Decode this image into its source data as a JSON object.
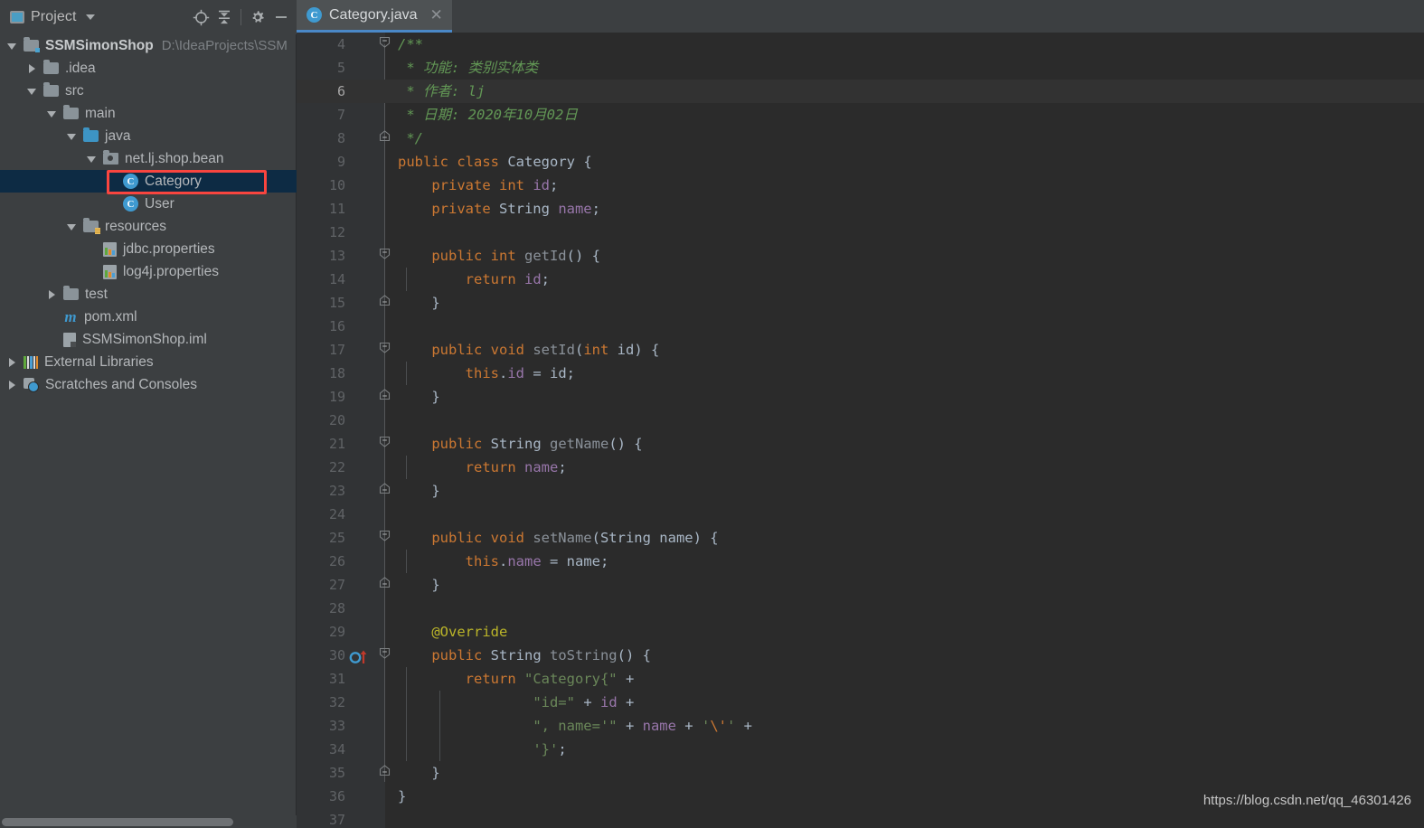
{
  "window": {
    "watermark": "https://blog.csdn.net/qq_46301426"
  },
  "project_panel": {
    "title": "Project",
    "title_icon": "project-view-icon",
    "dropdown_icon": "chevron-down-icon",
    "actions": [
      {
        "name": "locate-icon",
        "label": "Select Opened File"
      },
      {
        "name": "collapse-all-icon",
        "label": "Collapse All"
      },
      {
        "name": "gear-icon",
        "label": "Settings"
      },
      {
        "name": "minimize-icon",
        "label": "Hide"
      }
    ],
    "tree": [
      {
        "indent": 0,
        "twisty": "down",
        "icon": "module-folder-icon",
        "label": "SSMSimonShop",
        "bold": true,
        "path": "D:\\IdeaProjects\\SSM",
        "selected": false
      },
      {
        "indent": 1,
        "twisty": "right",
        "icon": "folder-icon",
        "label": ".idea",
        "bold": false,
        "path": "",
        "selected": false
      },
      {
        "indent": 1,
        "twisty": "down",
        "icon": "source-folder-icon",
        "label": "src",
        "bold": false,
        "path": "",
        "selected": false
      },
      {
        "indent": 2,
        "twisty": "down",
        "icon": "folder-icon",
        "label": "main",
        "bold": false,
        "path": "",
        "selected": false
      },
      {
        "indent": 3,
        "twisty": "down",
        "icon": "java-source-folder-icon",
        "label": "java",
        "bold": false,
        "path": "",
        "selected": false
      },
      {
        "indent": 4,
        "twisty": "down",
        "icon": "package-icon",
        "label": "net.lj.shop.bean",
        "bold": false,
        "path": "",
        "selected": false
      },
      {
        "indent": 5,
        "twisty": "none",
        "icon": "java-class-icon",
        "label": "Category",
        "bold": false,
        "path": "",
        "selected": true
      },
      {
        "indent": 5,
        "twisty": "none",
        "icon": "java-class-icon",
        "label": "User",
        "bold": false,
        "path": "",
        "selected": false
      },
      {
        "indent": 3,
        "twisty": "down",
        "icon": "resources-folder-icon",
        "label": "resources",
        "bold": false,
        "path": "",
        "selected": false
      },
      {
        "indent": 4,
        "twisty": "none",
        "icon": "properties-file-icon",
        "label": "jdbc.properties",
        "bold": false,
        "path": "",
        "selected": false
      },
      {
        "indent": 4,
        "twisty": "none",
        "icon": "properties-file-icon",
        "label": "log4j.properties",
        "bold": false,
        "path": "",
        "selected": false
      },
      {
        "indent": 2,
        "twisty": "right",
        "icon": "folder-icon",
        "label": "test",
        "bold": false,
        "path": "",
        "selected": false
      },
      {
        "indent": 2,
        "twisty": "none",
        "icon": "maven-icon",
        "label": "pom.xml",
        "bold": false,
        "path": "",
        "selected": false
      },
      {
        "indent": 2,
        "twisty": "none",
        "icon": "iml-file-icon",
        "label": "SSMSimonShop.iml",
        "bold": false,
        "path": "",
        "selected": false
      },
      {
        "indent": 0,
        "twisty": "right",
        "icon": "libraries-icon",
        "label": "External Libraries",
        "bold": false,
        "path": "",
        "selected": false
      },
      {
        "indent": 0,
        "twisty": "right",
        "icon": "scratches-icon",
        "label": "Scratches and Consoles",
        "bold": false,
        "path": "",
        "selected": false
      }
    ],
    "annotation": {
      "shape": "rectangle",
      "color": "#f8453f",
      "target": "Category"
    }
  },
  "editor": {
    "tab": {
      "label": "Category.java",
      "icon": "java-class-icon",
      "close_icon": "close-icon",
      "active": true,
      "accent_color": "#4a88c7"
    },
    "caret_line": 6,
    "first_visible_line": 4,
    "last_visible_line": 37,
    "gutter_markers": [
      {
        "line": 30,
        "name": "override-method-marker-icon"
      }
    ],
    "lines": [
      {
        "n": 4,
        "fold": "open-top",
        "tokens": [
          {
            "t": "/**",
            "c": "cmt"
          }
        ],
        "indent": 0
      },
      {
        "n": 5,
        "fold": "none",
        "tokens": [
          {
            "t": " * 功能: 类别实体类",
            "c": "cmt"
          }
        ],
        "indent": 0
      },
      {
        "n": 6,
        "fold": "none",
        "tokens": [
          {
            "t": " * 作者: lj",
            "c": "cmt"
          }
        ],
        "indent": 0
      },
      {
        "n": 7,
        "fold": "none",
        "tokens": [
          {
            "t": " * 日期: 2020年10月02日",
            "c": "cmt"
          }
        ],
        "indent": 0
      },
      {
        "n": 8,
        "fold": "close",
        "tokens": [
          {
            "t": " */",
            "c": "cmt"
          }
        ],
        "indent": 0
      },
      {
        "n": 9,
        "fold": "none",
        "tokens": [
          {
            "t": "public class ",
            "c": "kw"
          },
          {
            "t": "Category ",
            "c": "cls"
          },
          {
            "t": "{",
            "c": "punc"
          }
        ],
        "indent": 0
      },
      {
        "n": 10,
        "fold": "none",
        "tokens": [
          {
            "t": "    ",
            "c": "punc"
          },
          {
            "t": "private int ",
            "c": "kw"
          },
          {
            "t": "id",
            "c": "fld"
          },
          {
            "t": ";",
            "c": "punc"
          }
        ],
        "indent": 0
      },
      {
        "n": 11,
        "fold": "none",
        "tokens": [
          {
            "t": "    ",
            "c": "punc"
          },
          {
            "t": "private ",
            "c": "kw"
          },
          {
            "t": "String ",
            "c": "cls"
          },
          {
            "t": "name",
            "c": "fld"
          },
          {
            "t": ";",
            "c": "punc"
          }
        ],
        "indent": 0
      },
      {
        "n": 12,
        "fold": "none",
        "tokens": [],
        "indent": 0
      },
      {
        "n": 13,
        "fold": "open",
        "tokens": [
          {
            "t": "    ",
            "c": "punc"
          },
          {
            "t": "public int ",
            "c": "kw"
          },
          {
            "t": "getId",
            "c": "mth"
          },
          {
            "t": "() {",
            "c": "punc"
          }
        ],
        "indent": 0
      },
      {
        "n": 14,
        "fold": "none",
        "tokens": [
          {
            "t": "        ",
            "c": "punc"
          },
          {
            "t": "return ",
            "c": "kw"
          },
          {
            "t": "id",
            "c": "fld"
          },
          {
            "t": ";",
            "c": "punc"
          }
        ],
        "indent": 1
      },
      {
        "n": 15,
        "fold": "close",
        "tokens": [
          {
            "t": "    }",
            "c": "punc"
          }
        ],
        "indent": 0
      },
      {
        "n": 16,
        "fold": "none",
        "tokens": [],
        "indent": 0
      },
      {
        "n": 17,
        "fold": "open",
        "tokens": [
          {
            "t": "    ",
            "c": "punc"
          },
          {
            "t": "public void ",
            "c": "kw"
          },
          {
            "t": "setId",
            "c": "mth"
          },
          {
            "t": "(",
            "c": "punc"
          },
          {
            "t": "int ",
            "c": "kw"
          },
          {
            "t": "id",
            "c": "id"
          },
          {
            "t": ") {",
            "c": "punc"
          }
        ],
        "indent": 0
      },
      {
        "n": 18,
        "fold": "none",
        "tokens": [
          {
            "t": "        ",
            "c": "punc"
          },
          {
            "t": "this",
            "c": "kw"
          },
          {
            "t": ".",
            "c": "punc"
          },
          {
            "t": "id",
            "c": "fld"
          },
          {
            "t": " = id;",
            "c": "punc"
          }
        ],
        "indent": 1
      },
      {
        "n": 19,
        "fold": "close",
        "tokens": [
          {
            "t": "    }",
            "c": "punc"
          }
        ],
        "indent": 0
      },
      {
        "n": 20,
        "fold": "none",
        "tokens": [],
        "indent": 0
      },
      {
        "n": 21,
        "fold": "open",
        "tokens": [
          {
            "t": "    ",
            "c": "punc"
          },
          {
            "t": "public ",
            "c": "kw"
          },
          {
            "t": "String ",
            "c": "cls"
          },
          {
            "t": "getName",
            "c": "mth"
          },
          {
            "t": "() {",
            "c": "punc"
          }
        ],
        "indent": 0
      },
      {
        "n": 22,
        "fold": "none",
        "tokens": [
          {
            "t": "        ",
            "c": "punc"
          },
          {
            "t": "return ",
            "c": "kw"
          },
          {
            "t": "name",
            "c": "fld"
          },
          {
            "t": ";",
            "c": "punc"
          }
        ],
        "indent": 1
      },
      {
        "n": 23,
        "fold": "close",
        "tokens": [
          {
            "t": "    }",
            "c": "punc"
          }
        ],
        "indent": 0
      },
      {
        "n": 24,
        "fold": "none",
        "tokens": [],
        "indent": 0
      },
      {
        "n": 25,
        "fold": "open",
        "tokens": [
          {
            "t": "    ",
            "c": "punc"
          },
          {
            "t": "public void ",
            "c": "kw"
          },
          {
            "t": "setName",
            "c": "mth"
          },
          {
            "t": "(String name) {",
            "c": "punc"
          }
        ],
        "indent": 0
      },
      {
        "n": 26,
        "fold": "none",
        "tokens": [
          {
            "t": "        ",
            "c": "punc"
          },
          {
            "t": "this",
            "c": "kw"
          },
          {
            "t": ".",
            "c": "punc"
          },
          {
            "t": "name",
            "c": "fld"
          },
          {
            "t": " = name;",
            "c": "punc"
          }
        ],
        "indent": 1
      },
      {
        "n": 27,
        "fold": "close",
        "tokens": [
          {
            "t": "    }",
            "c": "punc"
          }
        ],
        "indent": 0
      },
      {
        "n": 28,
        "fold": "none",
        "tokens": [],
        "indent": 0
      },
      {
        "n": 29,
        "fold": "none",
        "tokens": [
          {
            "t": "    ",
            "c": "punc"
          },
          {
            "t": "@Override",
            "c": "anno"
          }
        ],
        "indent": 0
      },
      {
        "n": 30,
        "fold": "open",
        "tokens": [
          {
            "t": "    ",
            "c": "punc"
          },
          {
            "t": "public ",
            "c": "kw"
          },
          {
            "t": "String ",
            "c": "cls"
          },
          {
            "t": "toString",
            "c": "mth"
          },
          {
            "t": "() {",
            "c": "punc"
          }
        ],
        "indent": 0
      },
      {
        "n": 31,
        "fold": "none",
        "tokens": [
          {
            "t": "        ",
            "c": "punc"
          },
          {
            "t": "return ",
            "c": "kw"
          },
          {
            "t": "\"Category{\"",
            "c": "str"
          },
          {
            "t": " +",
            "c": "punc"
          }
        ],
        "indent": 1
      },
      {
        "n": 32,
        "fold": "none",
        "tokens": [
          {
            "t": "                ",
            "c": "punc"
          },
          {
            "t": "\"id=\"",
            "c": "str"
          },
          {
            "t": " + ",
            "c": "punc"
          },
          {
            "t": "id",
            "c": "fld"
          },
          {
            "t": " +",
            "c": "punc"
          }
        ],
        "indent": 2
      },
      {
        "n": 33,
        "fold": "none",
        "tokens": [
          {
            "t": "                ",
            "c": "punc"
          },
          {
            "t": "\", name='\"",
            "c": "str"
          },
          {
            "t": " + ",
            "c": "punc"
          },
          {
            "t": "name",
            "c": "fld"
          },
          {
            "t": " + ",
            "c": "punc"
          },
          {
            "t": "'",
            "c": "str"
          },
          {
            "t": "\\'",
            "c": "esc"
          },
          {
            "t": "'",
            "c": "str"
          },
          {
            "t": " +",
            "c": "punc"
          }
        ],
        "indent": 2
      },
      {
        "n": 34,
        "fold": "none",
        "tokens": [
          {
            "t": "                ",
            "c": "punc"
          },
          {
            "t": "'}'",
            "c": "str"
          },
          {
            "t": ";",
            "c": "punc"
          }
        ],
        "indent": 2
      },
      {
        "n": 35,
        "fold": "close",
        "tokens": [
          {
            "t": "    }",
            "c": "punc"
          }
        ],
        "indent": 0
      },
      {
        "n": 36,
        "fold": "none",
        "tokens": [
          {
            "t": "}",
            "c": "punc"
          }
        ],
        "indent": 0
      },
      {
        "n": 37,
        "fold": "none",
        "tokens": [],
        "indent": 0
      }
    ]
  }
}
